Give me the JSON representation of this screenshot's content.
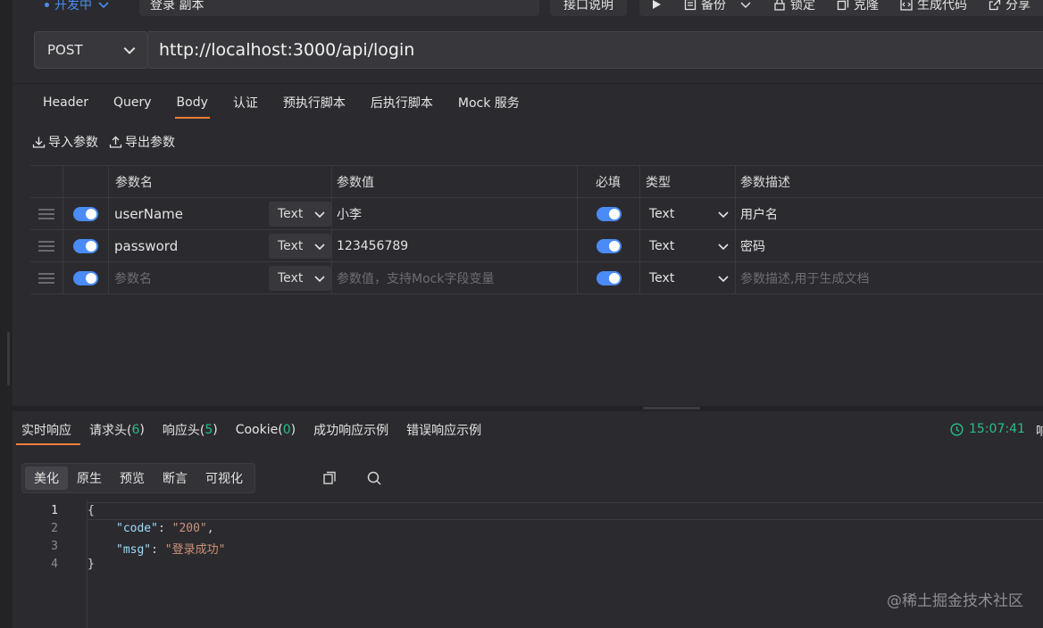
{
  "topbar": {
    "status": "开发中",
    "title": "登录 副本",
    "doc_button": "接口说明",
    "tools": [
      "备份",
      "锁定",
      "克隆",
      "生成代码",
      "分享"
    ]
  },
  "request": {
    "method": "POST",
    "url": "http://localhost:3000/api/login"
  },
  "tabs": [
    "Header",
    "Query",
    "Body",
    "认证",
    "预执行脚本",
    "后执行脚本",
    "Mock 服务"
  ],
  "active_tab": "Body",
  "io": {
    "import": "导入参数",
    "export": "导出参数"
  },
  "table": {
    "headers": {
      "name": "参数名",
      "value": "参数值",
      "required": "必填",
      "type": "类型",
      "desc": "参数描述"
    },
    "rows": [
      {
        "name": "userName",
        "name_type": "Text",
        "value": "小李",
        "type": "Text",
        "desc": "用户名"
      },
      {
        "name": "password",
        "name_type": "Text",
        "value": "123456789",
        "type": "Text",
        "desc": "密码"
      }
    ],
    "empty_row": {
      "name_placeholder": "参数名",
      "name_type": "Text",
      "value_placeholder": "参数值，支持Mock字段变量",
      "type": "Text",
      "desc_placeholder": "参数描述,用于生成文档"
    }
  },
  "response": {
    "tabs": [
      {
        "label": "实时响应",
        "count": ""
      },
      {
        "label": "请求头(",
        "count": "6",
        "suffix": ")"
      },
      {
        "label": "响应头(",
        "count": "5",
        "suffix": ")"
      },
      {
        "label": "Cookie(",
        "count": "0",
        "suffix": ")"
      },
      {
        "label": "成功响应示例",
        "count": ""
      },
      {
        "label": "错误响应示例",
        "count": ""
      }
    ],
    "time": "15:07:41",
    "time_cut": "响",
    "views": [
      "美化",
      "原生",
      "预览",
      "断言",
      "可视化"
    ],
    "code_lines": [
      "1",
      "2",
      "3",
      "4"
    ],
    "code": {
      "open": "{",
      "code_key": "\"code\"",
      "code_val": "\"200\"",
      "msg_key": "\"msg\"",
      "msg_val": "\"登录成功\"",
      "close": "}"
    }
  },
  "watermark": "@稀土掘金技术社区",
  "colors": {
    "accent": "#4a8bf5",
    "tab_underline": "#f07c3a",
    "success": "#23c08a"
  }
}
